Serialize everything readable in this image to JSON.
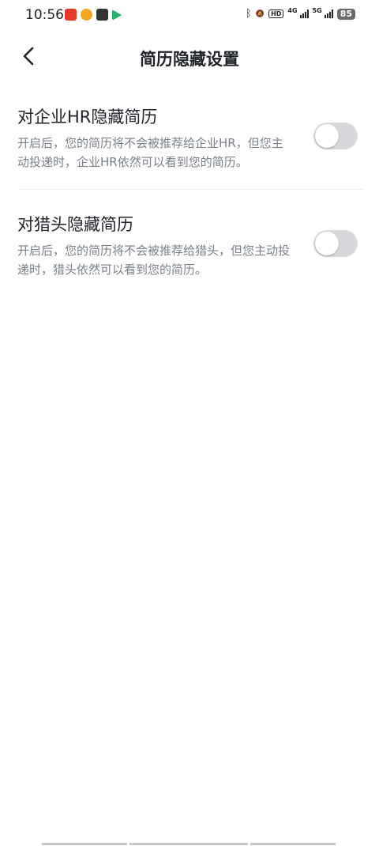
{
  "status_bar": {
    "time": "10:56",
    "net_4g": "4G",
    "net_5g": "5G",
    "hd": "HD",
    "battery": "85"
  },
  "header": {
    "title": "简历隐藏设置"
  },
  "settings": [
    {
      "title": "对企业HR隐藏简历",
      "description": "开启后，您的简历将不会被推荐给企业HR，但您主动投递时，企业HR依然可以看到您的简历。",
      "enabled": false
    },
    {
      "title": "对猎头隐藏简历",
      "description": "开启后，您的简历将不会被推荐给猎头，但您主动投递时，猎头依然可以看到您的简历。",
      "enabled": false
    }
  ],
  "colors": {
    "toggle_off": "#d7d8dc",
    "text_primary": "#1f2329",
    "text_secondary": "#7a8089"
  }
}
